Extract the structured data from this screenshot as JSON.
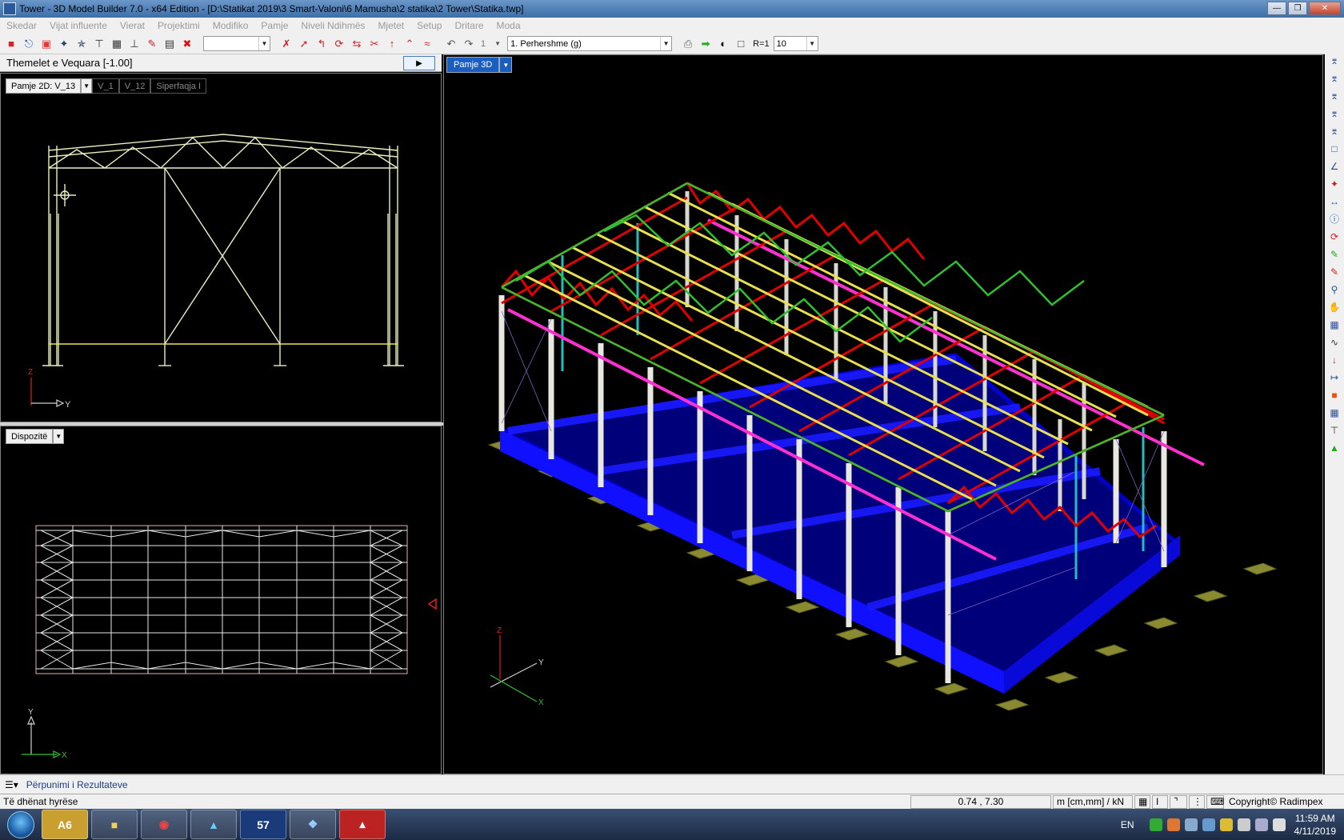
{
  "window": {
    "title": "Tower - 3D Model Builder 7.0 - x64 Edition - [D:\\Statikat 2019\\3 Smart-Valoni\\6 Mamusha\\2 statika\\2 Tower\\Statika.twp]"
  },
  "menu": [
    "Skedar",
    "Vijat influente",
    "Vierat",
    "Projektimi",
    "Modifiko",
    "Pamje",
    "Niveli Ndihmës",
    "Mjetet",
    "Setup",
    "Dritare",
    "Moda"
  ],
  "toolbar": {
    "empty_combo": "",
    "page_number": "1",
    "load_case": "1. Perhershme (g)",
    "ratio_label": "R=1",
    "ratio_value": "10"
  },
  "left_panel": {
    "title": "Themelet e Vequara   [-1.00]",
    "view_combo": "Pamje 2D: V_13",
    "tabs": [
      "V_1",
      "V_12",
      "Siperfaqja I"
    ],
    "axis_z": "Z",
    "axis_y": "Y"
  },
  "plan_panel": {
    "combo": "Dispozitë",
    "axis_y": "Y",
    "axis_x": "X"
  },
  "view3d": {
    "tab": "Pamje 3D",
    "axis_z": "Z",
    "axis_y": "Y",
    "axis_x": "X"
  },
  "bottom_strip": {
    "label": "Përpunimi i Rezultateve"
  },
  "statusbar": {
    "left": "Të dhënat hyrëse",
    "coords": "0.74 , 7.30",
    "units": "m [cm,mm] / kN",
    "copyright": "Copyright© Radimpex"
  },
  "taskbar": {
    "lang": "EN",
    "time": "11:59 AM",
    "date": "4/11/2019",
    "apps": [
      "A6",
      "",
      "",
      "",
      "57",
      "",
      ""
    ]
  },
  "colors": {
    "truss_red": "#e00000",
    "purlin_yellow": "#e8e050",
    "brace_green": "#30c030",
    "slab_blue": "#0000e8",
    "column_white": "#e8e8e0",
    "footing_olive": "#8a8a30",
    "magenta": "#ff30d0",
    "cyan": "#20c0c0"
  }
}
